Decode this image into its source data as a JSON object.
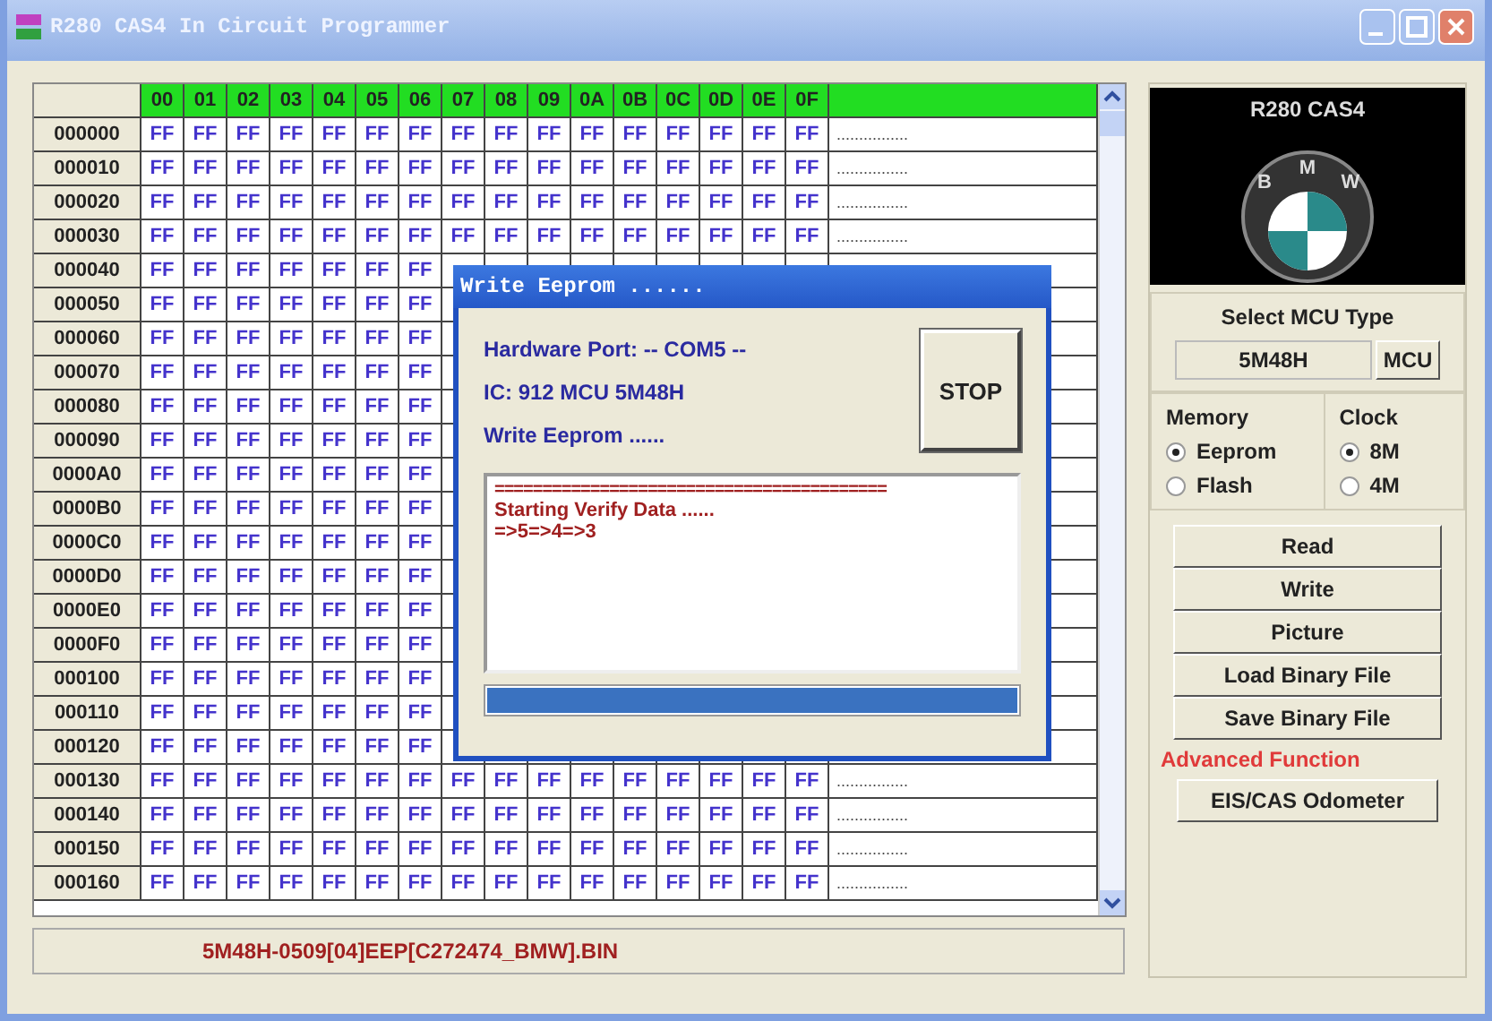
{
  "window": {
    "title": "R280 CAS4 In Circuit Programmer"
  },
  "hex_table": {
    "columns": [
      "00",
      "01",
      "02",
      "03",
      "04",
      "05",
      "06",
      "07",
      "08",
      "09",
      "0A",
      "0B",
      "0C",
      "0D",
      "0E",
      "0F"
    ],
    "rows": [
      {
        "address": "000000",
        "cells": [
          "FF",
          "FF",
          "FF",
          "FF",
          "FF",
          "FF",
          "FF",
          "FF",
          "FF",
          "FF",
          "FF",
          "FF",
          "FF",
          "FF",
          "FF",
          "FF"
        ],
        "ascii": "................"
      },
      {
        "address": "000010",
        "cells": [
          "FF",
          "FF",
          "FF",
          "FF",
          "FF",
          "FF",
          "FF",
          "FF",
          "FF",
          "FF",
          "FF",
          "FF",
          "FF",
          "FF",
          "FF",
          "FF"
        ],
        "ascii": "................"
      },
      {
        "address": "000020",
        "cells": [
          "FF",
          "FF",
          "FF",
          "FF",
          "FF",
          "FF",
          "FF",
          "FF",
          "FF",
          "FF",
          "FF",
          "FF",
          "FF",
          "FF",
          "FF",
          "FF"
        ],
        "ascii": "................"
      },
      {
        "address": "000030",
        "cells": [
          "FF",
          "FF",
          "FF",
          "FF",
          "FF",
          "FF",
          "FF",
          "FF",
          "FF",
          "FF",
          "FF",
          "FF",
          "FF",
          "FF",
          "FF",
          "FF"
        ],
        "ascii": "................"
      },
      {
        "address": "000040",
        "cells": [
          "FF",
          "FF",
          "FF",
          "FF",
          "FF",
          "FF",
          "FF"
        ]
      },
      {
        "address": "000050",
        "cells": [
          "FF",
          "FF",
          "FF",
          "FF",
          "FF",
          "FF",
          "FF"
        ]
      },
      {
        "address": "000060",
        "cells": [
          "FF",
          "FF",
          "FF",
          "FF",
          "FF",
          "FF",
          "FF"
        ]
      },
      {
        "address": "000070",
        "cells": [
          "FF",
          "FF",
          "FF",
          "FF",
          "FF",
          "FF",
          "FF"
        ]
      },
      {
        "address": "000080",
        "cells": [
          "FF",
          "FF",
          "FF",
          "FF",
          "FF",
          "FF",
          "FF"
        ]
      },
      {
        "address": "000090",
        "cells": [
          "FF",
          "FF",
          "FF",
          "FF",
          "FF",
          "FF",
          "FF"
        ]
      },
      {
        "address": "0000A0",
        "cells": [
          "FF",
          "FF",
          "FF",
          "FF",
          "FF",
          "FF",
          "FF"
        ]
      },
      {
        "address": "0000B0",
        "cells": [
          "FF",
          "FF",
          "FF",
          "FF",
          "FF",
          "FF",
          "FF"
        ]
      },
      {
        "address": "0000C0",
        "cells": [
          "FF",
          "FF",
          "FF",
          "FF",
          "FF",
          "FF",
          "FF"
        ]
      },
      {
        "address": "0000D0",
        "cells": [
          "FF",
          "FF",
          "FF",
          "FF",
          "FF",
          "FF",
          "FF"
        ]
      },
      {
        "address": "0000E0",
        "cells": [
          "FF",
          "FF",
          "FF",
          "FF",
          "FF",
          "FF",
          "FF"
        ]
      },
      {
        "address": "0000F0",
        "cells": [
          "FF",
          "FF",
          "FF",
          "FF",
          "FF",
          "FF",
          "FF"
        ]
      },
      {
        "address": "000100",
        "cells": [
          "FF",
          "FF",
          "FF",
          "FF",
          "FF",
          "FF",
          "FF"
        ]
      },
      {
        "address": "000110",
        "cells": [
          "FF",
          "FF",
          "FF",
          "FF",
          "FF",
          "FF",
          "FF"
        ]
      },
      {
        "address": "000120",
        "cells": [
          "FF",
          "FF",
          "FF",
          "FF",
          "FF",
          "FF",
          "FF"
        ]
      },
      {
        "address": "000130",
        "cells": [
          "FF",
          "FF",
          "FF",
          "FF",
          "FF",
          "FF",
          "FF",
          "FF",
          "FF",
          "FF",
          "FF",
          "FF",
          "FF",
          "FF",
          "FF",
          "FF"
        ],
        "ascii": "................"
      },
      {
        "address": "000140",
        "cells": [
          "FF",
          "FF",
          "FF",
          "FF",
          "FF",
          "FF",
          "FF",
          "FF",
          "FF",
          "FF",
          "FF",
          "FF",
          "FF",
          "FF",
          "FF",
          "FF"
        ],
        "ascii": "................"
      },
      {
        "address": "000150",
        "cells": [
          "FF",
          "FF",
          "FF",
          "FF",
          "FF",
          "FF",
          "FF",
          "FF",
          "FF",
          "FF",
          "FF",
          "FF",
          "FF",
          "FF",
          "FF",
          "FF"
        ],
        "ascii": "................"
      },
      {
        "address": "000160",
        "cells": [
          "FF",
          "FF",
          "FF",
          "FF",
          "FF",
          "FF",
          "FF",
          "FF",
          "FF",
          "FF",
          "FF",
          "FF",
          "FF",
          "FF",
          "FF",
          "FF"
        ],
        "ascii": "................"
      }
    ]
  },
  "status_bar": {
    "file": "5M48H-0509[04]EEP[C272474_BMW].BIN"
  },
  "logo": {
    "caption": "R280 CAS4",
    "ring_letters": [
      "B",
      "M",
      "W"
    ]
  },
  "mcu": {
    "title": "Select MCU Type",
    "value": "5M48H",
    "button": "MCU"
  },
  "memory": {
    "title": "Memory",
    "options": [
      {
        "label": "Eeprom",
        "selected": true
      },
      {
        "label": "Flash",
        "selected": false
      }
    ]
  },
  "clock": {
    "title": "Clock",
    "options": [
      {
        "label": "8M",
        "selected": true
      },
      {
        "label": "4M",
        "selected": false
      }
    ]
  },
  "actions": [
    "Read",
    "Write",
    "Picture",
    "Load Binary File",
    "Save Binary File"
  ],
  "advanced": {
    "title": "Advanced Function",
    "buttons": [
      "EIS/CAS Odometer"
    ]
  },
  "dialog": {
    "title": "Write Eeprom ......",
    "lines": [
      "Hardware Port: -- COM5 --",
      "IC: 912 MCU 5M48H",
      "Write Eeprom ......"
    ],
    "stop": "STOP",
    "log": {
      "separator": "=========================================",
      "lines": [
        "Starting Verify Data ......",
        "=>5=>4=>3"
      ]
    },
    "progress": {
      "level": 1
    }
  }
}
